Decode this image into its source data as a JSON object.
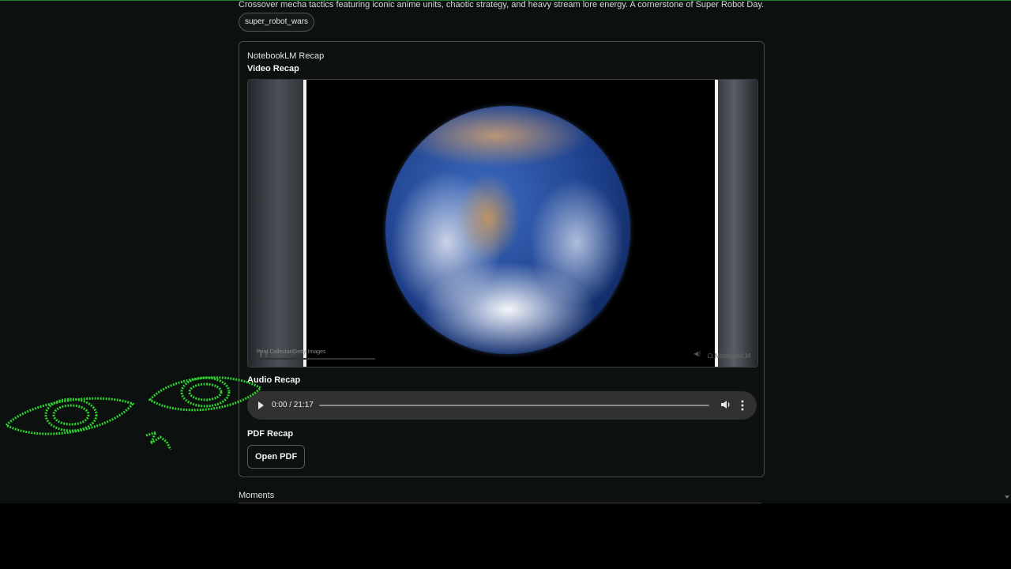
{
  "header": {
    "description": "Crossover mecha tactics featuring iconic anime units, chaotic strategy, and heavy stream lore energy. A cornerstone of Super Robot Day.",
    "tag": "super_robot_wars"
  },
  "recap_card": {
    "title": "NotebookLM Recap",
    "video": {
      "heading": "Video Recap",
      "time_text": "0:30 / 4",
      "credit": "Print Collector/Getty Images",
      "brand": "NotebookLM"
    },
    "audio": {
      "heading": "Audio Recap",
      "time": "0:00 / 21:17",
      "progress": 0
    },
    "pdf": {
      "heading": "PDF Recap",
      "button_label": "Open PDF"
    }
  },
  "moments": {
    "heading": "Moments"
  },
  "colors": {
    "page_bg": "#0c100f",
    "accent_green": "#1f7a2a",
    "eye_overlay": "#2ed12e"
  },
  "icons": [
    "play-icon",
    "pause-icon",
    "volume-icon",
    "more-options-icon",
    "fullscreen-icon",
    "eye-icon"
  ]
}
